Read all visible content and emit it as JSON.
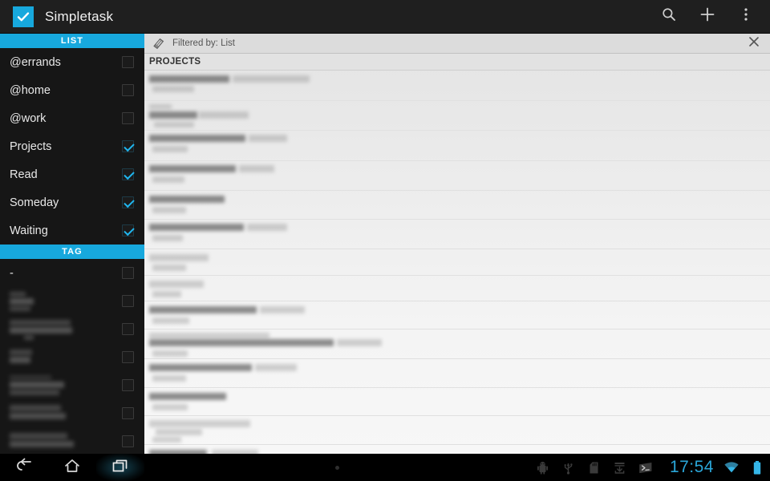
{
  "app": {
    "title": "Simpletask",
    "logo_icon": "check-square-logo",
    "accent_color": "#17a8dd"
  },
  "action_bar": {
    "buttons": [
      {
        "name": "search-button",
        "icon": "search-icon"
      },
      {
        "name": "add-task-button",
        "icon": "plus-icon"
      },
      {
        "name": "overflow-menu-button",
        "icon": "overflow-menu-icon"
      }
    ]
  },
  "sidebar": {
    "list_section": {
      "header": "LIST",
      "items": [
        {
          "label": "@errands",
          "checked": false,
          "redacted": false
        },
        {
          "label": "@home",
          "checked": false,
          "redacted": false
        },
        {
          "label": "@work",
          "checked": false,
          "redacted": false
        },
        {
          "label": "Projects",
          "checked": true,
          "redacted": false
        },
        {
          "label": "Read",
          "checked": true,
          "redacted": false
        },
        {
          "label": "Someday",
          "checked": true,
          "redacted": false
        },
        {
          "label": "Waiting",
          "checked": true,
          "redacted": false
        }
      ]
    },
    "tag_section": {
      "header": "TAG",
      "items": [
        {
          "label": "-",
          "checked": false,
          "redacted": false
        },
        {
          "label": "",
          "checked": false,
          "redacted": true
        },
        {
          "label": "",
          "checked": false,
          "redacted": true
        },
        {
          "label": "",
          "checked": false,
          "redacted": true
        },
        {
          "label": "",
          "checked": false,
          "redacted": true
        },
        {
          "label": "",
          "checked": false,
          "redacted": true
        },
        {
          "label": "",
          "checked": false,
          "redacted": true
        }
      ]
    }
  },
  "main": {
    "filter_bar": {
      "icon": "tag-icon",
      "text": "Filtered by: List",
      "close_icon": "close-icon"
    },
    "list_header": "PROJECTS",
    "tasks": [
      {
        "redacted": true,
        "primary_width": 196,
        "secondary_width": 55
      },
      {
        "redacted": true,
        "primary_width": 120,
        "secondary_width": 56
      },
      {
        "redacted": true,
        "primary_width": 168,
        "secondary_width": 48
      },
      {
        "redacted": true,
        "primary_width": 152,
        "secondary_width": 44
      },
      {
        "redacted": true,
        "primary_width": 100,
        "secondary_width": 46
      },
      {
        "redacted": true,
        "primary_width": 170,
        "secondary_width": 42
      },
      {
        "redacted": true,
        "primary_width": 84,
        "secondary_width": 44
      },
      {
        "redacted": true,
        "primary_width": 78,
        "secondary_width": 40
      },
      {
        "redacted": true,
        "primary_width": 196,
        "secondary_width": 48
      },
      {
        "redacted": true,
        "primary_width": 292,
        "secondary_width": 50
      },
      {
        "redacted": true,
        "primary_width": 190,
        "secondary_width": 44
      },
      {
        "redacted": true,
        "primary_width": 112,
        "secondary_width": 46
      },
      {
        "redacted": true,
        "primary_width": 186,
        "secondary_width": 40
      },
      {
        "redacted": true,
        "primary_width": 136,
        "secondary_width": 0
      }
    ]
  },
  "system_bar": {
    "nav": [
      {
        "name": "back-button",
        "icon": "back-icon"
      },
      {
        "name": "home-button",
        "icon": "home-icon"
      },
      {
        "name": "recent-apps-button",
        "icon": "recent-apps-icon",
        "active": true
      }
    ],
    "tray_icons": [
      "android-debug-icon",
      "usb-icon",
      "sd-card-icon",
      "download-icon",
      "adb-terminal-icon"
    ],
    "clock": "17:54",
    "status_icons": [
      "wifi-icon",
      "battery-icon"
    ],
    "clock_color": "#2aa6d8"
  }
}
